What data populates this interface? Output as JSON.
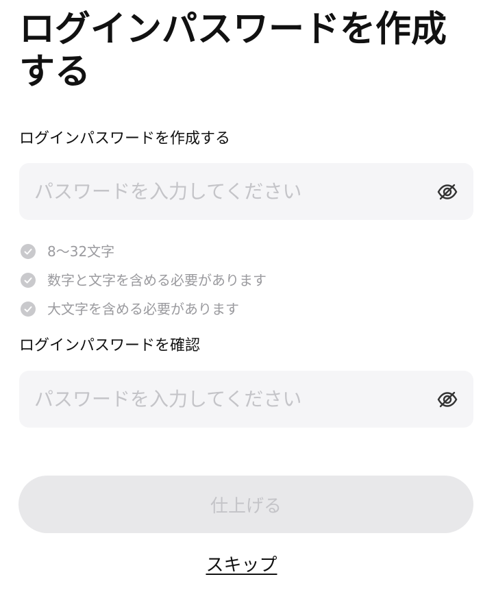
{
  "page": {
    "title": "ログインパスワードを作成する"
  },
  "password_field": {
    "label": "ログインパスワードを作成する",
    "placeholder": "パスワードを入力してください",
    "value": "",
    "toggle_icon": "eye-off-icon"
  },
  "rules": [
    {
      "text": "8〜32文字",
      "icon": "check-circle-icon",
      "satisfied": false
    },
    {
      "text": "数字と文字を含める必要があります",
      "icon": "check-circle-icon",
      "satisfied": false
    },
    {
      "text": "大文字を含める必要があります",
      "icon": "check-circle-icon",
      "satisfied": false
    }
  ],
  "confirm_field": {
    "label": "ログインパスワードを確認",
    "placeholder": "パスワードを入力してください",
    "value": "",
    "toggle_icon": "eye-off-icon"
  },
  "actions": {
    "submit_label": "仕上げる",
    "submit_enabled": false,
    "skip_label": "スキップ"
  },
  "colors": {
    "text_primary": "#111111",
    "text_muted": "#9a9a9e",
    "placeholder": "#c4c4c8",
    "input_bg": "#f5f5f7",
    "button_disabled_bg": "#e8e8ea",
    "check_inactive": "#c9c9cc"
  }
}
